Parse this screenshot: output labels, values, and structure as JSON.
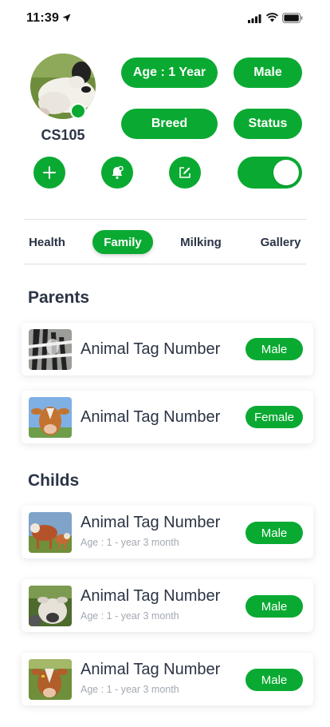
{
  "status_bar": {
    "time": "11:39"
  },
  "profile": {
    "animal_id": "CS105",
    "age_label": "Age : 1 Year",
    "gender_label": "Male",
    "breed_label": "Breed",
    "status_label": "Status",
    "toggle_on": true
  },
  "tabs": [
    {
      "label": "Health",
      "active": false
    },
    {
      "label": "Family",
      "active": true
    },
    {
      "label": "Milking",
      "active": false
    },
    {
      "label": "Gallery",
      "active": false
    }
  ],
  "parents": {
    "title": "Parents",
    "items": [
      {
        "name": "Animal Tag Number",
        "sex": "Male",
        "image": "zebra-photo"
      },
      {
        "name": "Animal Tag Number",
        "sex": "Female",
        "image": "cow-photo"
      }
    ]
  },
  "childs": {
    "title": "Childs",
    "items": [
      {
        "name": "Animal Tag Number",
        "age": "Age : 1 - year 3 month",
        "sex": "Male",
        "image": "cow-calf-photo"
      },
      {
        "name": "Animal Tag Number",
        "age": "Age : 1 - year 3 month",
        "sex": "Male",
        "image": "white-calf-photo"
      },
      {
        "name": "Animal Tag Number",
        "age": "Age : 1 - year 3 month",
        "sex": "Male",
        "image": "brown-cow-photo"
      }
    ]
  },
  "colors": {
    "accent": "#0aaa32",
    "text": "#2b3445",
    "muted": "#a3a9b1"
  },
  "icons": [
    "location-arrow-icon",
    "signal-icon",
    "wifi-icon",
    "battery-icon",
    "plus-icon",
    "bell-icon",
    "edit-icon"
  ]
}
